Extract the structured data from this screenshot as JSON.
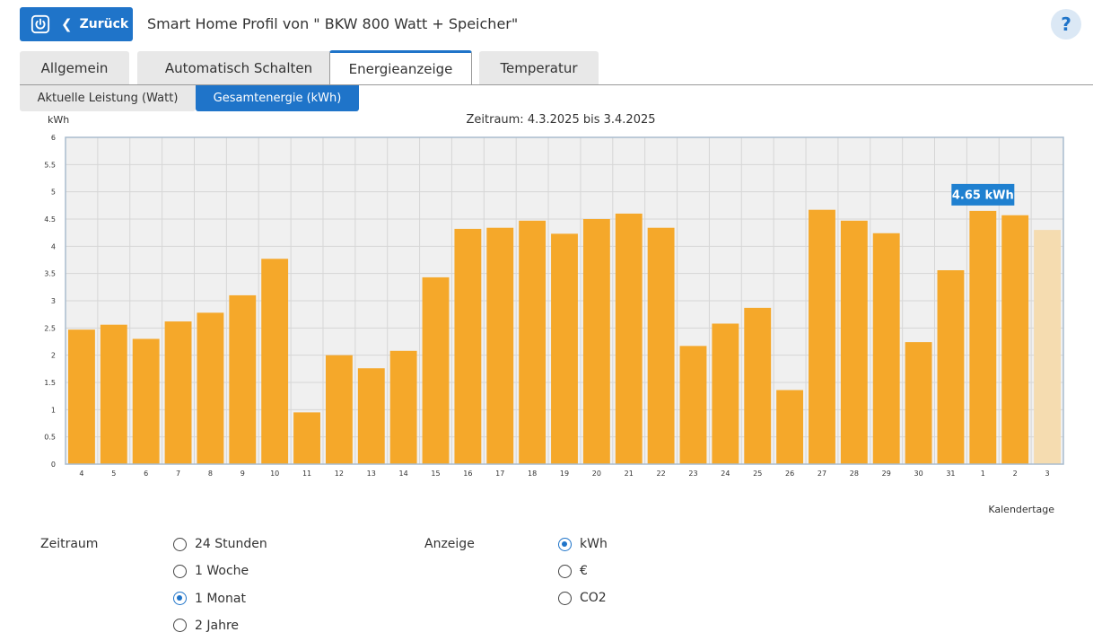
{
  "header": {
    "back_label": "Zurück",
    "title": "Smart Home Profil von \" BKW 800 Watt + Speicher\"",
    "help_label": "?"
  },
  "tabs": [
    {
      "label": "Allgemein",
      "active": false
    },
    {
      "label": "Automatisch Schalten",
      "active": false
    },
    {
      "label": "Energieanzeige",
      "active": true
    },
    {
      "label": "Temperatur",
      "active": false
    }
  ],
  "subtabs": [
    {
      "label": "Aktuelle Leistung (Watt)",
      "active": false
    },
    {
      "label": "Gesamtenergie (kWh)",
      "active": true
    }
  ],
  "chart_data": {
    "type": "bar",
    "title": "Zeitraum: 4.3.2025 bis 3.4.2025",
    "ylabel": "kWh",
    "xlabel": "Kalendertage",
    "ylim": [
      0,
      6
    ],
    "yticks": [
      "0",
      "0.5",
      "1",
      "1.5",
      "2",
      "2.5",
      "3",
      "3.5",
      "4",
      "4.5",
      "5",
      "5.5",
      "6"
    ],
    "grid": true,
    "categories": [
      "4",
      "5",
      "6",
      "7",
      "8",
      "9",
      "10",
      "11",
      "12",
      "13",
      "14",
      "15",
      "16",
      "17",
      "18",
      "19",
      "20",
      "21",
      "22",
      "23",
      "24",
      "25",
      "26",
      "27",
      "28",
      "29",
      "30",
      "31",
      "1",
      "2",
      "3"
    ],
    "values": [
      2.47,
      2.56,
      2.3,
      2.62,
      2.78,
      3.1,
      3.77,
      0.95,
      2.0,
      1.76,
      2.08,
      3.43,
      4.32,
      4.34,
      4.47,
      4.23,
      4.5,
      4.6,
      4.34,
      2.17,
      2.58,
      2.87,
      1.36,
      4.67,
      4.47,
      4.24,
      2.24,
      3.56,
      4.65,
      4.57,
      4.3
    ],
    "highlight_index": 30,
    "tooltip": {
      "index": 28,
      "text": "4.65 kWh"
    },
    "colors": {
      "bar": "#f5a82a",
      "bar_faded": "#f5dcb0",
      "tooltip": "#1f80d0",
      "plot_bg": "#f0f0f0"
    }
  },
  "controls": {
    "zeitraum": {
      "label": "Zeitraum",
      "options": [
        {
          "label": "24 Stunden",
          "checked": false
        },
        {
          "label": "1 Woche",
          "checked": false
        },
        {
          "label": "1 Monat",
          "checked": true
        },
        {
          "label": "2 Jahre",
          "checked": false
        }
      ]
    },
    "anzeige": {
      "label": "Anzeige",
      "options": [
        {
          "label": "kWh",
          "checked": true
        },
        {
          "label": "€",
          "checked": false
        },
        {
          "label": "CO2",
          "checked": false
        }
      ]
    }
  }
}
